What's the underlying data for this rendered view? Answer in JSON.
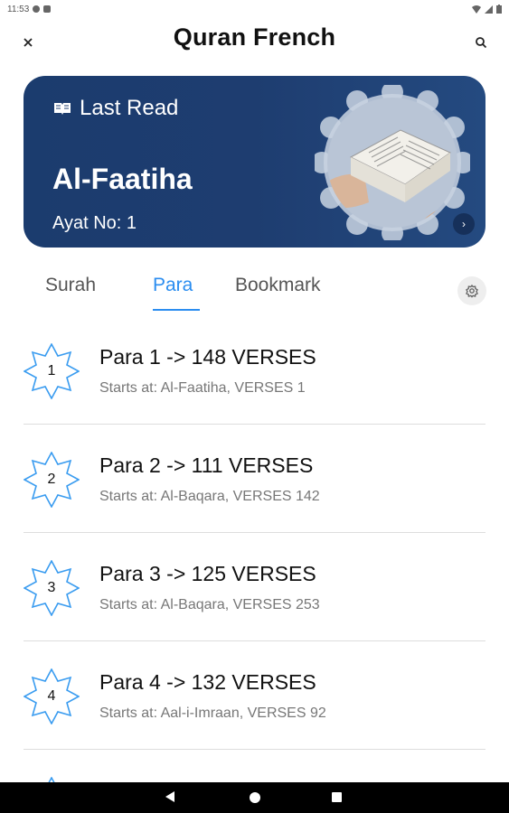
{
  "status_bar": {
    "time": "11:53"
  },
  "app_bar": {
    "title": "Quran French"
  },
  "last_read": {
    "label": "Last Read",
    "surah": "Al-Faatiha",
    "ayat": "Ayat No: 1",
    "arrow_glyph": "›"
  },
  "tabs": [
    {
      "label": "Surah",
      "active": false
    },
    {
      "label": "Para",
      "active": true
    },
    {
      "label": "Bookmark",
      "active": false
    }
  ],
  "paras": [
    {
      "number": "1",
      "title": "Para 1 -> 148 VERSES",
      "starts": "Starts at: Al-Faatiha, VERSES 1"
    },
    {
      "number": "2",
      "title": "Para 2 -> 111 VERSES",
      "starts": "Starts at: Al-Baqara, VERSES 142"
    },
    {
      "number": "3",
      "title": "Para 3 -> 125 VERSES",
      "starts": "Starts at: Al-Baqara, VERSES 253"
    },
    {
      "number": "4",
      "title": "Para 4 -> 132 VERSES",
      "starts": "Starts at: Aal-i-Imraan, VERSES 92"
    }
  ],
  "icons": {
    "close": "close-icon",
    "search": "search-icon",
    "book": "book-icon",
    "settings": "gear-icon",
    "star": "eight-point-star-icon"
  },
  "colors": {
    "accent": "#2b8df0",
    "card_bg": "#1e3d70",
    "star_stroke": "#3a9cf0",
    "divider": "#dddddd"
  }
}
